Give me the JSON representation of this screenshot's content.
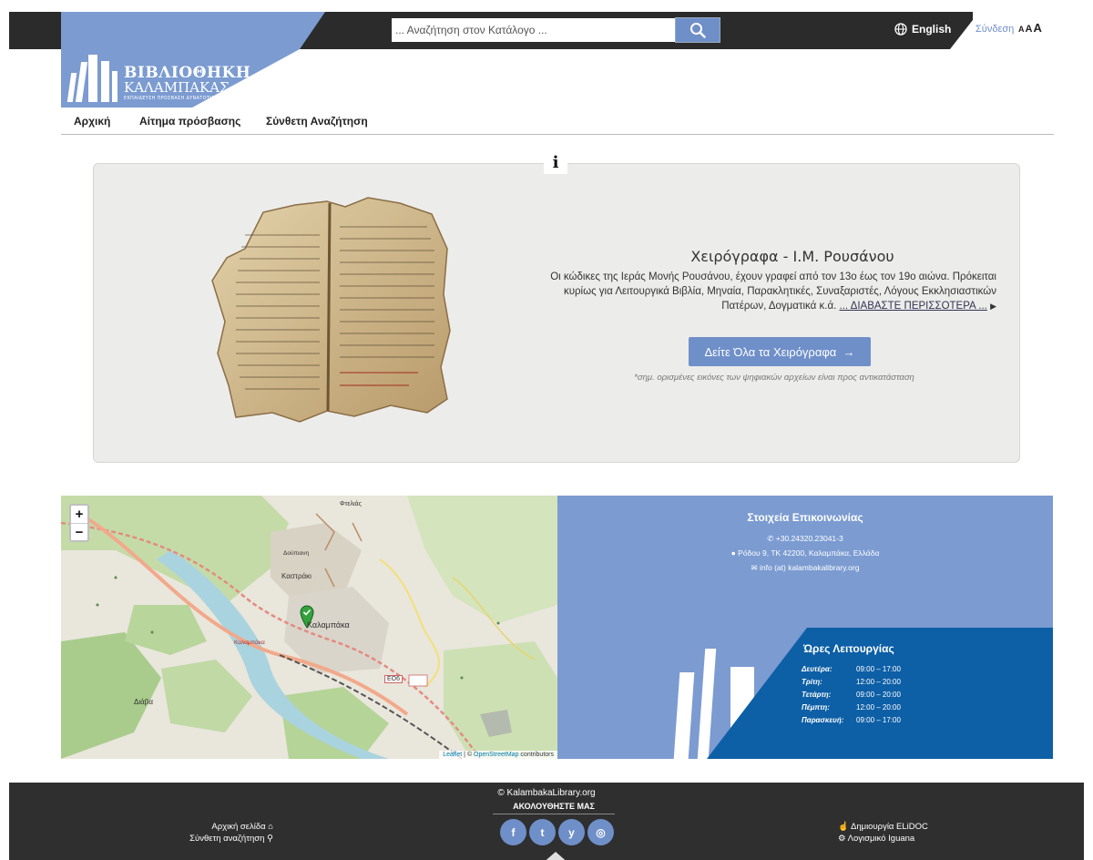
{
  "header": {
    "logo_line1": "ΒΙΒΛΙΟΘΗΚΗ",
    "logo_line2": "ΚΑΛΑΜΠΑΚΑΣ",
    "logo_tagline": "ΕΚΠΑΙΔΕΥΣΗ ΠΡΟΣΒΑΣΗ ΔΥΝΑΤΟΤΗΤΑ",
    "search_placeholder": "... Αναζήτηση στον Κατάλογο ...",
    "language": "English",
    "login": "Σύνδεση",
    "font_sizes": [
      "A",
      "A",
      "A"
    ]
  },
  "nav": {
    "items": [
      "Αρχική",
      "Αίτημα πρόσβασης",
      "Σύνθετη Αναζήτηση"
    ]
  },
  "feature": {
    "info_glyph": "i",
    "title": "Χειρόγραφα - Ι.Μ. Ρουσάνου",
    "description": "Οι κώδικες της Ιεράς Μονής Ρουσάνου, έχουν γραφεί από τον 13ο έως τον 19ο αιώνα. Πρόκειται κυρίως για Λειτουργικά Βιβλία, Μηναία, Παρακλητικές, Συναξαριστές, Λόγους Εκκλησιαστικών Πατέρων, Δογματικά κ.ά.",
    "read_more": "... ΔΙΑΒΑΣΤΕ ΠΕΡΙΣΣΟΤΕΡΑ ...",
    "button": "Δείτε Όλα τα Χειρόγραφα",
    "note": "*σημ. ορισμένες εικόνες των ψηφιακών αρχείων είναι προς αντικατάσταση"
  },
  "map": {
    "zoom_in": "+",
    "zoom_out": "−",
    "attribution_leaflet": "Leaflet",
    "attribution_osm": "OpenStreetMap",
    "attribution_suffix": "contributors",
    "labels": {
      "kastraki": "Καστράκι",
      "kalampaka": "Καλαμπάκα",
      "kalampaka2": "Καλαμπάκα",
      "diava": "Διάβα",
      "e06": "ΕΟ6",
      "fylakes": "Φτελιάς",
      "dust": "Δούπιανη",
      "kal12": "12"
    }
  },
  "contact": {
    "title": "Στοιχεία Επικοινωνίας",
    "phone": "+30.24320.23041-3",
    "address": "Ρόδου 9, ΤΚ 42200, Καλαμπάκα, Ελλάδα",
    "email": "info (at) kalambakalibrary.org",
    "hours_title": "Ώρες Λειτουργίας",
    "hours": [
      {
        "day": "Δευτέρα:",
        "time": "09:00 – 17:00"
      },
      {
        "day": "Τρίτη:",
        "time": "12:00 – 20:00"
      },
      {
        "day": "Τετάρτη:",
        "time": "09:00 – 20:00"
      },
      {
        "day": "Πέμπτη:",
        "time": "12:00 – 20:00"
      },
      {
        "day": "Παρασκευή:",
        "time": "09:00 – 17:00"
      }
    ]
  },
  "footer": {
    "copyright": "© KalambakaLibrary.org",
    "follow": "ΑΚΟΛΟΥΘΗΣΤΕ ΜΑΣ",
    "social": [
      "f",
      "t",
      "y",
      "◎"
    ],
    "left_links": [
      "Αρχική σελίδα",
      "Σύνθετη αναζήτηση"
    ],
    "right_links": [
      "Δημιουργία ELiDOC",
      "Λογισμικό Iguana"
    ]
  },
  "colors": {
    "accent": "#7b9bd1",
    "dark_blue": "#0d5fa6",
    "bar": "#2b2b2b"
  }
}
